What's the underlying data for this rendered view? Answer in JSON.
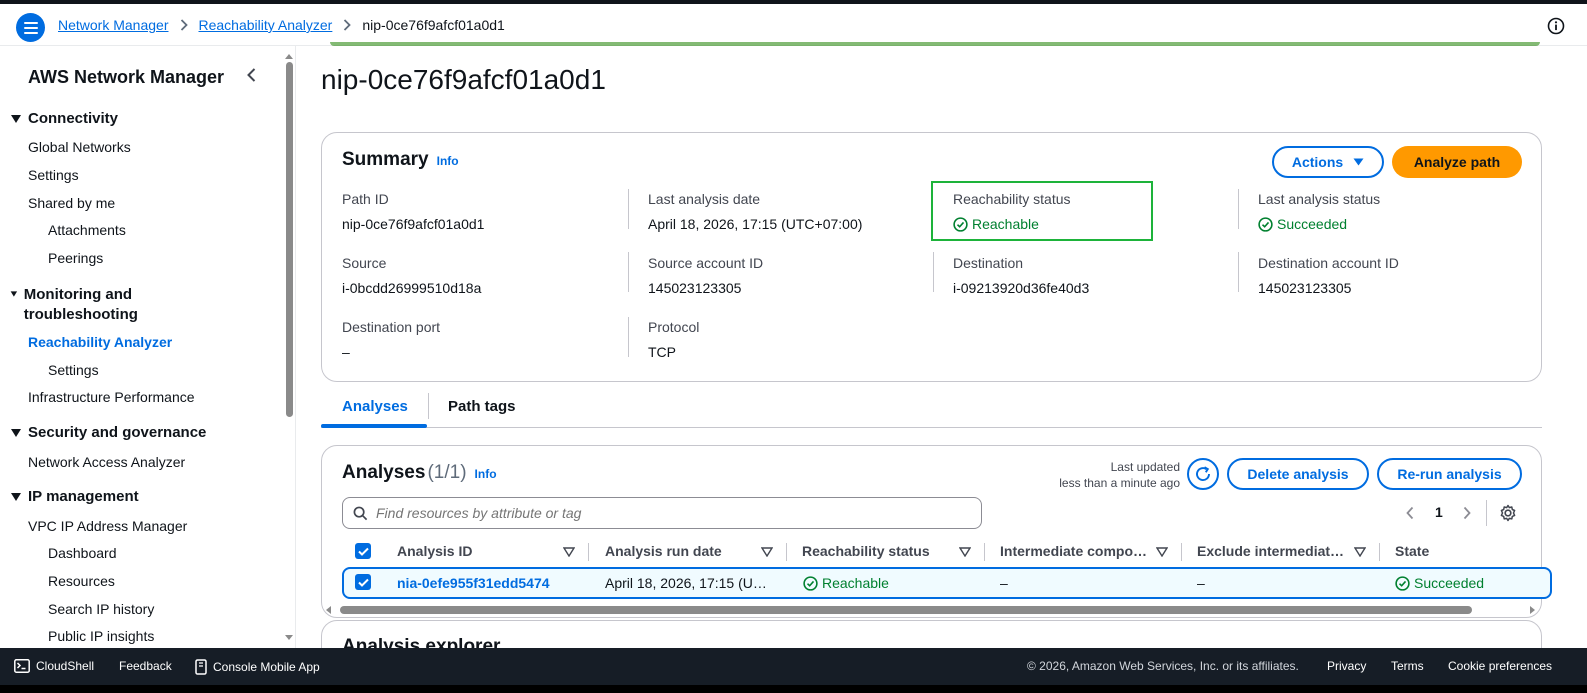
{
  "breadcrumb": {
    "items": [
      "Network Manager",
      "Reachability Analyzer"
    ],
    "current": "nip-0ce76f9afcf01a0d1"
  },
  "sidebar": {
    "title": "AWS Network Manager",
    "sections": {
      "connectivity": "Connectivity",
      "monitoring": "Monitoring and troubleshooting",
      "security": "Security and governance",
      "ip": "IP management"
    },
    "items": {
      "global_networks": "Global Networks",
      "settings": "Settings",
      "shared_by_me": "Shared by me",
      "attachments": "Attachments",
      "peerings": "Peerings",
      "reachability_analyzer": "Reachability Analyzer",
      "ra_settings": "Settings",
      "infra_perf": "Infrastructure Performance",
      "network_access_analyzer": "Network Access Analyzer",
      "vpc_ipam": "VPC IP Address Manager",
      "dashboard": "Dashboard",
      "resources": "Resources",
      "search_ip_history": "Search IP history",
      "public_ip_insights": "Public IP insights"
    }
  },
  "page": {
    "title": "nip-0ce76f9afcf01a0d1"
  },
  "summary": {
    "heading": "Summary",
    "info": "Info",
    "actions_label": "Actions",
    "analyze_label": "Analyze path",
    "fields": {
      "path_id_label": "Path ID",
      "path_id": "nip-0ce76f9afcf01a0d1",
      "last_analysis_date_label": "Last analysis date",
      "last_analysis_date": "April 18, 2026, 17:15 (UTC+07:00)",
      "reachability_status_label": "Reachability status",
      "reachability_status": "Reachable",
      "last_analysis_status_label": "Last analysis status",
      "last_analysis_status": "Succeeded",
      "source_label": "Source",
      "source": "i-0bcdd26999510d18a",
      "source_account_label": "Source account ID",
      "source_account": "145023123305",
      "destination_label": "Destination",
      "destination": "i-09213920d36fe40d3",
      "destination_account_label": "Destination account ID",
      "destination_account": "145023123305",
      "destination_port_label": "Destination port",
      "destination_port": "–",
      "protocol_label": "Protocol",
      "protocol": "TCP"
    }
  },
  "tabs": {
    "analyses": "Analyses",
    "path_tags": "Path tags"
  },
  "analyses": {
    "heading": "Analyses",
    "count": "(1/1)",
    "info": "Info",
    "last_updated_1": "Last updated",
    "last_updated_2": "less than a minute ago",
    "delete_label": "Delete analysis",
    "rerun_label": "Re-run analysis",
    "search_placeholder": "Find resources by attribute or tag",
    "page_number": "1",
    "columns": [
      "Analysis ID",
      "Analysis run date",
      "Reachability status",
      "Intermediate compo…",
      "Exclude intermediat…",
      "State"
    ],
    "row": {
      "id": "nia-0efe955f31edd5474",
      "run_date": "April 18, 2026, 17:15 (U…",
      "status": "Reachable",
      "intermediate": "–",
      "exclude": "–",
      "state": "Succeeded"
    }
  },
  "explorer": {
    "heading": "Analysis explorer"
  },
  "footer": {
    "cloudshell": "CloudShell",
    "feedback": "Feedback",
    "console_mobile": "Console Mobile App",
    "copyright": "© 2026, Amazon Web Services, Inc. or its affiliates.",
    "privacy": "Privacy",
    "terms": "Terms",
    "cookie": "Cookie preferences"
  },
  "colors": {
    "accent": "#006ce0",
    "success": "#00802f",
    "primary_button": "#ff9900",
    "footer_bg": "#161d26"
  }
}
